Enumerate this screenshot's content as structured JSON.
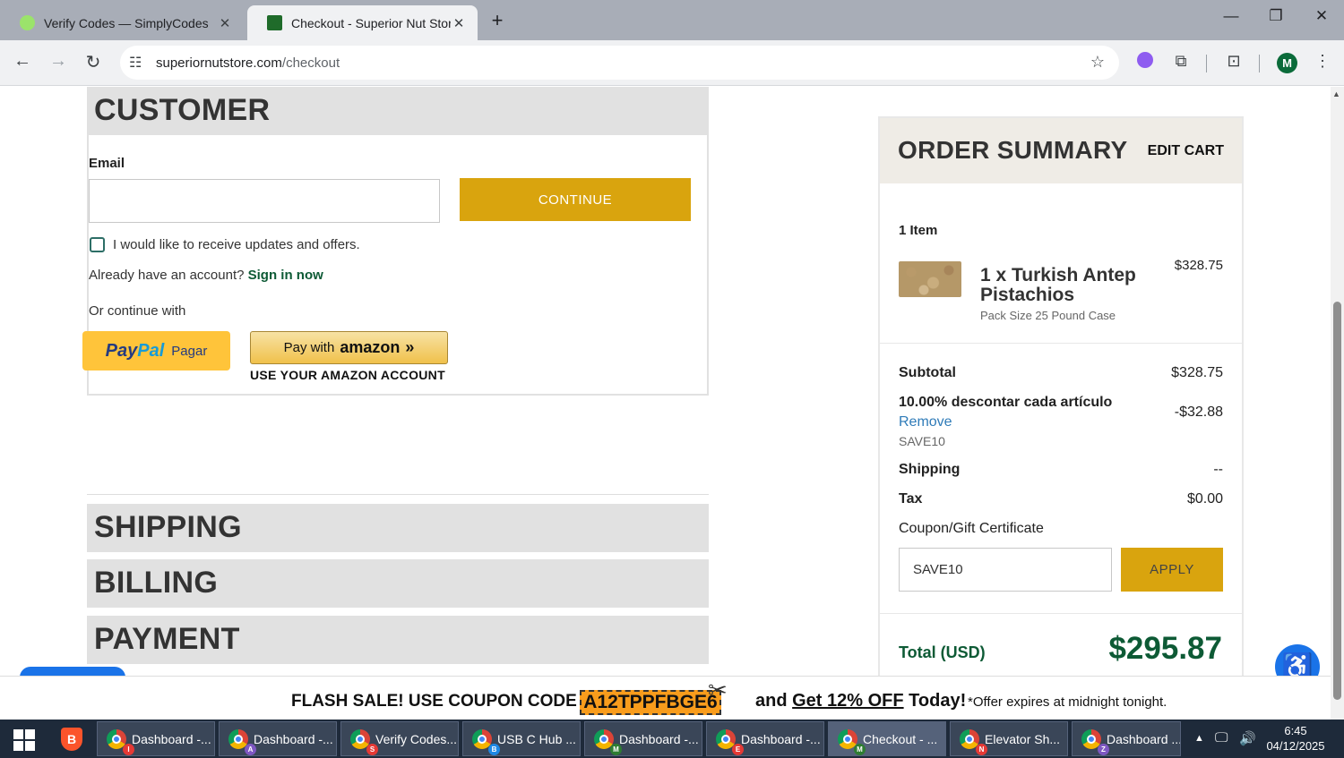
{
  "browser": {
    "tabs": [
      {
        "title": "Verify Codes — SimplyCodes",
        "favicon_color": "#34c759"
      },
      {
        "title": "Checkout - Superior Nut Store",
        "favicon_color": "#1f6b2a"
      }
    ],
    "url_host": "superiornutstore.com",
    "url_path": "/checkout",
    "avatar_initial": "M"
  },
  "customer": {
    "heading": "CUSTOMER",
    "email_label": "Email",
    "email_value": "",
    "continue_label": "CONTINUE",
    "updates_label": "I would like to receive updates and offers.",
    "account_prompt": "Already have an account?",
    "sign_in_label": "Sign in now",
    "continue_with": "Or continue with",
    "paypal_text_1": "Pay",
    "paypal_text_2": "Pal",
    "paypal_suffix": "Pagar",
    "amazon_prefix": "Pay with",
    "amazon_brand": "amazon",
    "amazon_note": "USE YOUR AMAZON ACCOUNT"
  },
  "sections": {
    "shipping": "SHIPPING",
    "billing": "BILLING",
    "payment": "PAYMENT"
  },
  "summary": {
    "title": "ORDER SUMMARY",
    "edit_cart": "EDIT CART",
    "item_count": "1 Item",
    "product_name": "1 x Turkish Antep Pistachios",
    "product_price": "$328.75",
    "product_option": "Pack Size 25 Pound Case",
    "subtotal_label": "Subtotal",
    "subtotal_value": "$328.75",
    "discount_label": "10.00% descontar cada artículo",
    "discount_remove": "Remove",
    "discount_code": "SAVE10",
    "discount_value": "-$32.88",
    "shipping_label": "Shipping",
    "shipping_value": "--",
    "tax_label": "Tax",
    "tax_value": "$0.00",
    "coupon_label": "Coupon/Gift Certificate",
    "coupon_value": "SAVE10",
    "apply_label": "APPLY",
    "total_label": "Total (USD)",
    "total_value": "$295.87"
  },
  "flash_banner": {
    "lead": "FLASH SALE! USE COUPON CODE",
    "code": "A12TPPFBGE6",
    "mid": "and",
    "offer": "Get 12% OFF",
    "tail": "Today!",
    "note": "*Offer expires at midnight tonight."
  },
  "taskbar": {
    "items": [
      {
        "label": "Dashboard -...",
        "badge": "I",
        "badge_color": "#e53935"
      },
      {
        "label": "Dashboard -...",
        "badge": "A",
        "badge_color": "#7e57c2"
      },
      {
        "label": "Verify Codes...",
        "badge": "S",
        "badge_color": "#e53935"
      },
      {
        "label": "USB C Hub ...",
        "badge": "B",
        "badge_color": "#1e88e5"
      },
      {
        "label": "Dashboard -...",
        "badge": "M",
        "badge_color": "#2e7d32"
      },
      {
        "label": "Dashboard -...",
        "badge": "E",
        "badge_color": "#e53935"
      },
      {
        "label": "Checkout - ...",
        "badge": "M",
        "badge_color": "#2e7d32"
      },
      {
        "label": "Elevator Sh...",
        "badge": "N",
        "badge_color": "#e53935"
      },
      {
        "label": "Dashboard ...",
        "badge": "Z",
        "badge_color": "#7e57c2"
      }
    ],
    "time": "6:45",
    "date": "04/12/2025"
  }
}
